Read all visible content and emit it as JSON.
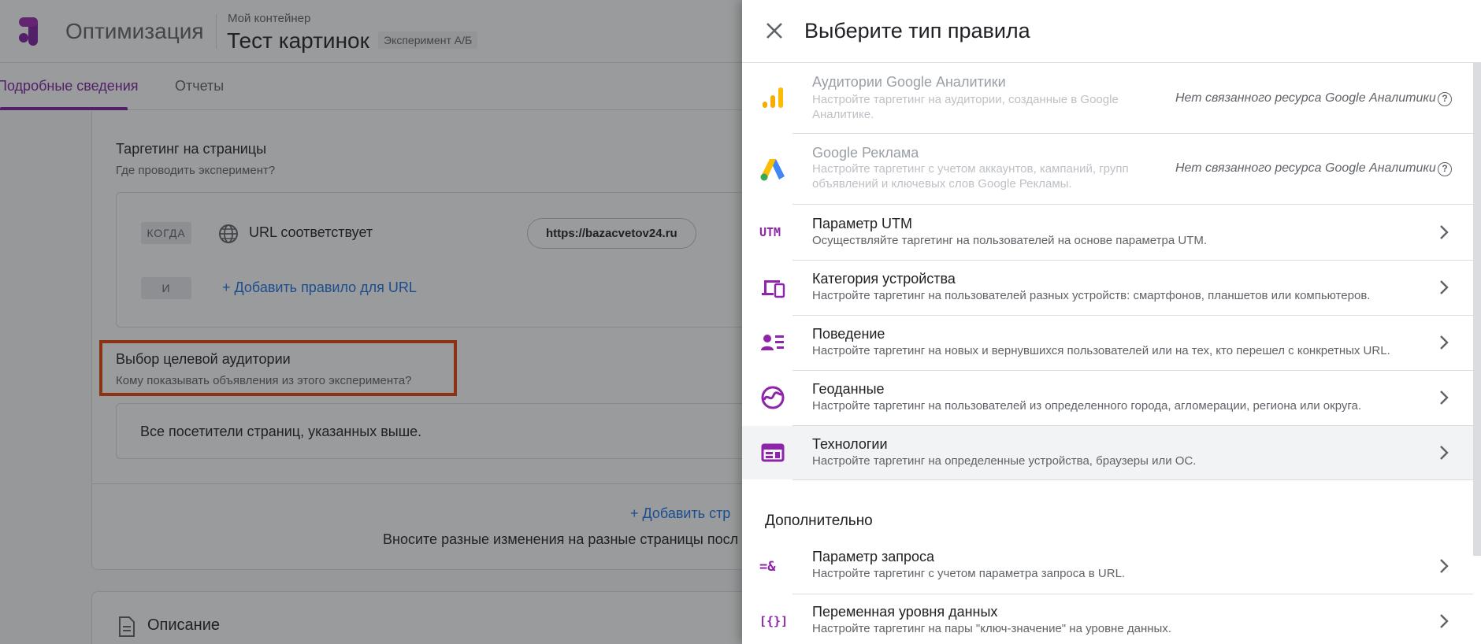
{
  "app": {
    "name": "Оптимизация",
    "container_label": "Мой контейнер",
    "experiment_name": "Тест картинок",
    "experiment_type": "Эксперимент А/Б"
  },
  "tabs": [
    {
      "label": "Подробные сведения",
      "active": true
    },
    {
      "label": "Отчеты",
      "active": false
    }
  ],
  "page_targeting": {
    "title": "Таргетинг на страницы",
    "subtitle": "Где проводить эксперимент?",
    "when_chip": "КОГДА",
    "and_chip": "И",
    "condition": "URL соответствует",
    "url_value": "https://bazacvetov24.ru",
    "add_url_rule": "+ Добавить правило для URL"
  },
  "audience": {
    "title": "Выбор целевой аудитории",
    "subtitle": "Кому показывать объявления из этого эксперимента?",
    "value": "Все посетители страниц, указанных выше."
  },
  "add_page": {
    "label": "+ Добавить стр",
    "description": "Вносите разные изменения на разные страницы посл"
  },
  "description_section": {
    "title": "Описание"
  },
  "panel": {
    "title": "Выберите тип правила",
    "rules": [
      {
        "icon": "analytics-bars-icon",
        "label": "Аудитории Google Аналитики",
        "description": "Настройте таргетинг на аудитории, созданные в Google Аналитике.",
        "note": "Нет связанного ресурса Google Аналитики",
        "disabled": true
      },
      {
        "icon": "google-ads-icon",
        "label": "Google Реклама",
        "description": "Настройте таргетинг с учетом аккаунтов, кампаний, групп объявлений и ключевых слов Google Рекламы.",
        "note": "Нет связанного ресурса Google Аналитики",
        "disabled": true
      },
      {
        "icon": "utm-icon",
        "icon_text": "UTM",
        "label": "Параметр UTM",
        "description": "Осуществляйте таргетинг на пользователей на основе параметра UTM."
      },
      {
        "icon": "devices-icon",
        "label": "Категория устройства",
        "description": "Настройте таргетинг на пользователей разных устройств: смартфонов, планшетов или компьютеров."
      },
      {
        "icon": "behavior-icon",
        "label": "Поведение",
        "description": "Настройте таргетинг на новых и вернувшихся пользователей или на тех, кто перешел с конкретных URL."
      },
      {
        "icon": "geo-icon",
        "label": "Геоданные",
        "description": "Настройте таргетинг на пользователей из определенного города, агломерации, региона или округа."
      },
      {
        "icon": "technology-icon",
        "label": "Технологии",
        "description": "Настройте таргетинг на определенные устройства, браузеры или ОС.",
        "selected": true
      }
    ],
    "additional_heading": "Дополнительно",
    "additional_rules": [
      {
        "icon": "query-param-icon",
        "icon_text": "=&",
        "label": "Параметр запроса",
        "description": "Настройте таргетинг с учетом параметра запроса в URL."
      },
      {
        "icon": "data-layer-icon",
        "icon_text": "[{}]",
        "label": "Переменная уровня данных",
        "description": "Настройте таргетинг на пары \"ключ-значение\" на уровне данных."
      }
    ]
  },
  "colors": {
    "accent_purple": "#8e24aa",
    "link_blue": "#1a73e8",
    "highlight_orange": "#e8430a"
  }
}
